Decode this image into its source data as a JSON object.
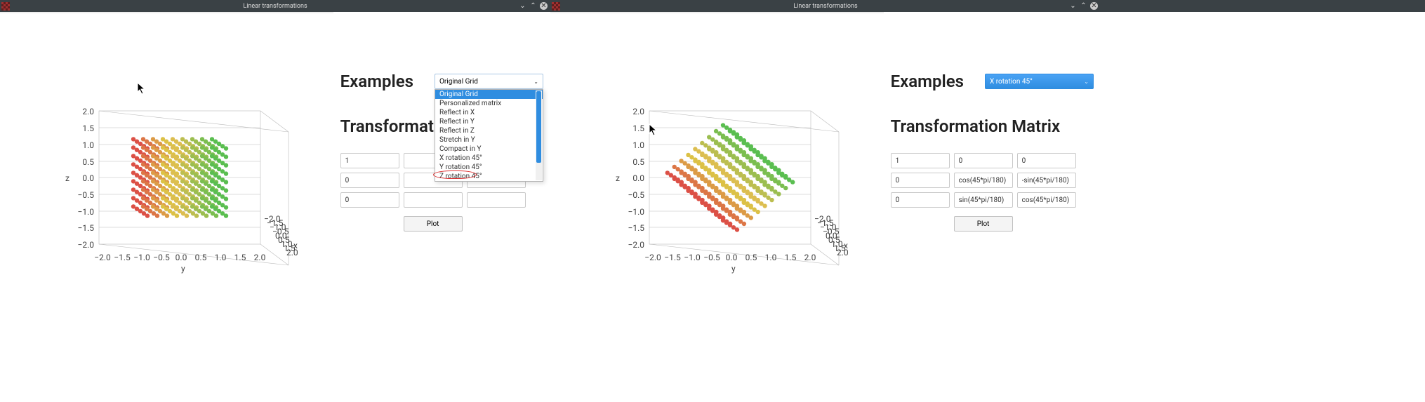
{
  "window_title": "Linear transformations",
  "labels": {
    "examples_heading": "Examples",
    "matrix_heading": "Transformation Matrix",
    "plot_button": "Plot",
    "axis_y": "y",
    "axis_z": "z"
  },
  "controls": {
    "minimize_title": "Minimize",
    "maximize_title": "Maximize",
    "close_title": "Close"
  },
  "dropdown": {
    "selected_left": "Original Grid",
    "selected_right": "X rotation 45°",
    "options": [
      "Original Grid",
      "Personalized matrix",
      "Reflect in X",
      "Reflect in Y",
      "Reflect in Z",
      "Stretch in Y",
      "Compact in Y",
      "X rotation 45°",
      "Y rotation 45°",
      "Z rotation 45°"
    ]
  },
  "matrix_left": [
    [
      "1",
      "",
      ""
    ],
    [
      "0",
      "",
      ""
    ],
    [
      "0",
      "",
      ""
    ]
  ],
  "matrix_right": [
    [
      "1",
      "0",
      "0"
    ],
    [
      "0",
      "cos(45*pi/180)",
      "-sin(45*pi/180)"
    ],
    [
      "0",
      "sin(45*pi/180)",
      "cos(45*pi/180)"
    ]
  ],
  "axis_ticks": [
    "-2.0",
    "-1.5",
    "-1.0",
    "-0.5",
    "0.0",
    "0.5",
    "1.0",
    "1.5",
    "2.0"
  ],
  "chart_data": {
    "type": "scatter",
    "title": "",
    "x_axis": "y",
    "y_axis": "z",
    "depth_axis": "x",
    "x_range": [
      -2,
      2
    ],
    "y_range": [
      -2,
      2
    ],
    "z_range": [
      -2,
      2
    ],
    "color_mapping": "depth_axis value (x) → hue from red (-2) through yellow/orange (0) to green (+2)",
    "left_plot": {
      "transform": "identity (original grid)",
      "grid_values": [
        -2,
        -1.5,
        -1,
        -0.5,
        0,
        0.5,
        1,
        1.5,
        2
      ]
    },
    "right_plot": {
      "transform": "45° rotation about X axis",
      "grid_values": [
        -2,
        -1.5,
        -1,
        -0.5,
        0,
        0.5,
        1,
        1.5,
        2
      ]
    }
  }
}
